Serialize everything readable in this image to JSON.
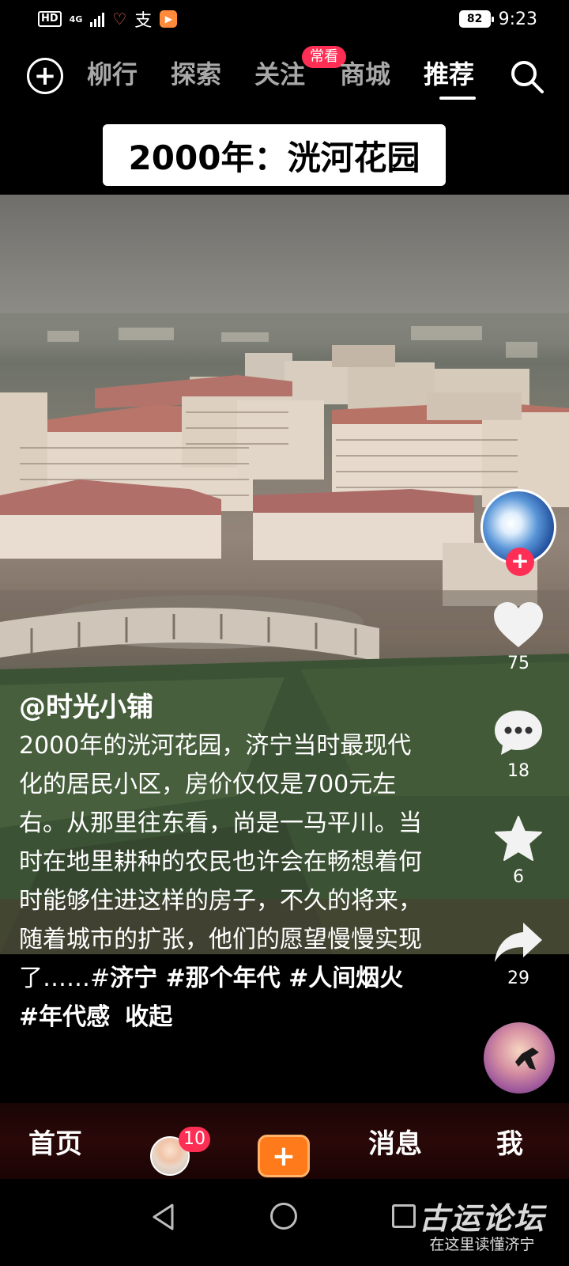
{
  "status_bar": {
    "hd": "HD",
    "network": "4G",
    "battery": "82",
    "time": "9:23"
  },
  "top_nav": {
    "tabs": [
      {
        "label": "柳行",
        "active": false
      },
      {
        "label": "探索",
        "active": false
      },
      {
        "label": "关注",
        "active": false
      },
      {
        "label": "商城",
        "active": false
      },
      {
        "label": "推荐",
        "active": true
      }
    ],
    "follow_badge": "常看"
  },
  "video": {
    "title_banner": "2000年：洸河花园"
  },
  "side_actions": {
    "like_count": "75",
    "comment_count": "18",
    "favorite_count": "6",
    "share_count": "29"
  },
  "post": {
    "author": "@时光小铺",
    "caption_text": "2000年的洸河花园，济宁当时最现代化的居民小区，房价仅仅是700元左右。从那里往东看，尚是一马平川。当时在地里耕种的农民也许会在畅想着何时能够住进这样的房子，不久的将来，随着城市的扩张，他们的愿望慢慢实现了……#",
    "hashtags": "济宁 #那个年代 #人间烟火 #年代感",
    "collapse_label": "收起"
  },
  "bottom_nav": {
    "home": "首页",
    "friends_badge": "10",
    "messages": "消息",
    "me": "我"
  },
  "watermark": {
    "main": "古运论坛",
    "sub": "在这里读懂济宁"
  },
  "colors": {
    "accent_red": "#ff2e55",
    "create_orange": "#ff7a1a"
  }
}
